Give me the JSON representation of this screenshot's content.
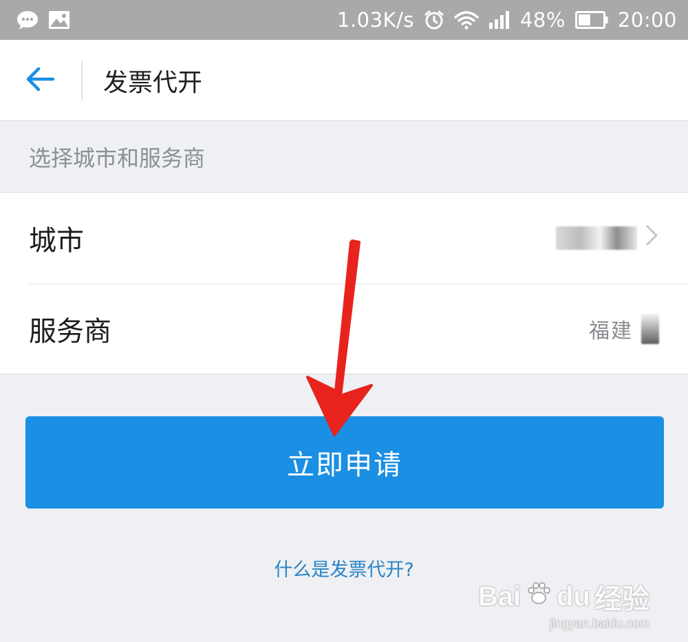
{
  "status_bar": {
    "network_speed": "1.03K/s",
    "battery_percent": "48%",
    "battery_level": 0.48,
    "time": "20:00",
    "icons": [
      "chat-icon",
      "image-icon",
      "alarm-icon",
      "wifi-icon",
      "signal-icon",
      "battery-icon"
    ]
  },
  "header": {
    "back_icon": "arrow-left-icon",
    "title": "发票代开"
  },
  "section": {
    "label": "选择城市和服务商"
  },
  "list": {
    "rows": [
      {
        "label": "城市",
        "value": "",
        "chevron": "chevron-right-icon"
      },
      {
        "label": "服务商",
        "value": "福建"
      }
    ]
  },
  "apply_button": {
    "label": "立即申请"
  },
  "help_link": {
    "label": "什么是发票代开?"
  },
  "watermark": {
    "brand": "Bai",
    "brand_tail": "du",
    "brand_cn": "经验",
    "url": "jingyan.baidu.com"
  },
  "colors": {
    "status_bar": "#a9a9a9",
    "accent": "#1a8fe3",
    "link": "#2a84c6",
    "arrow": "#e8231d",
    "background": "#eef0f3"
  }
}
